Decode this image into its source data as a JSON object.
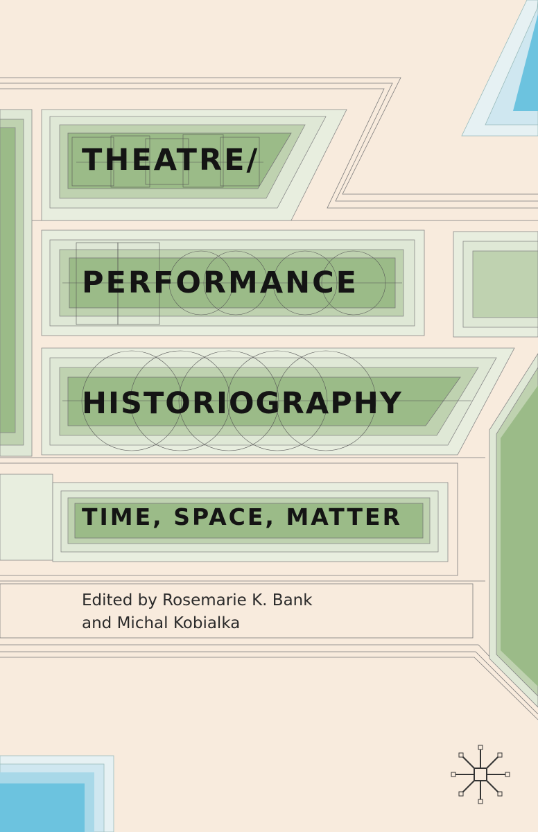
{
  "cover": {
    "title_line_1": "THEATRE/",
    "title_line_2": "PERFORMANCE",
    "title_line_3": "HISTORIOGRAPHY",
    "subtitle": "TIME, SPACE, MATTER",
    "editors_line_1": "Edited by Rosemarie K. Bank",
    "editors_line_2": "and Michal Kobialka"
  },
  "colors": {
    "background": "#f8ebdd",
    "green_light": "#dfe8d6",
    "green_mid": "#bfd2b0",
    "green_dark": "#9bbb88",
    "blue_light": "#cfe7f0",
    "blue_dark": "#6cc3df",
    "text": "#141414"
  },
  "icons": {
    "publisher_logo": "palgrave-logo-icon"
  }
}
